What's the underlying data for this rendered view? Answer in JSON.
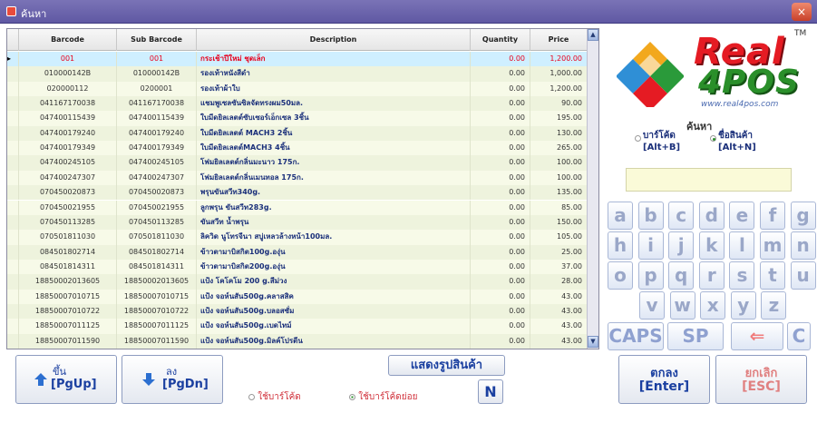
{
  "window": {
    "title": "ค้นหา",
    "close_label": "×"
  },
  "grid": {
    "columns": [
      "Barcode",
      "Sub Barcode",
      "Description",
      "Quantity",
      "Price"
    ],
    "rows": [
      {
        "marker": "▸",
        "barcode": "001",
        "sub": "001",
        "desc": "กระเช้าปีใหม่ ชุดเล็ก",
        "qty": "0.00",
        "price": "1,200.00"
      },
      {
        "marker": "",
        "barcode": "010000142B",
        "sub": "010000142B",
        "desc": "รองเท้าหนังสีดำ",
        "qty": "0.00",
        "price": "1,000.00"
      },
      {
        "marker": "",
        "barcode": "020000112",
        "sub": "0200001",
        "desc": "รองเท้าผ้าใบ",
        "qty": "0.00",
        "price": "1,200.00"
      },
      {
        "marker": "",
        "barcode": "041167170038",
        "sub": "041167170038",
        "desc": "แชมพูเซลซันซิลจัดทรงผม50มล.",
        "qty": "0.00",
        "price": "90.00"
      },
      {
        "marker": "",
        "barcode": "047400115439",
        "sub": "047400115439",
        "desc": "ใบมีดยิลเลตต์ซับเซอร์เอ็กเซล 3ชิ้น",
        "qty": "0.00",
        "price": "195.00"
      },
      {
        "marker": "",
        "barcode": "047400179240",
        "sub": "047400179240",
        "desc": "ใบมีดยิลเลตต์ MACH3 2ชิ้น",
        "qty": "0.00",
        "price": "130.00"
      },
      {
        "marker": "",
        "barcode": "047400179349",
        "sub": "047400179349",
        "desc": "ใบมีดยิลเลตต์MACH3 4ชิ้น",
        "qty": "0.00",
        "price": "265.00"
      },
      {
        "marker": "",
        "barcode": "047400245105",
        "sub": "047400245105",
        "desc": "โฟมยิลเลตต์กลิ่นมะนาว 175ก.",
        "qty": "0.00",
        "price": "100.00"
      },
      {
        "marker": "",
        "barcode": "047400247307",
        "sub": "047400247307",
        "desc": "โฟมยิลเลตต์กลิ่นเมนทอล 175ก.",
        "qty": "0.00",
        "price": "100.00"
      },
      {
        "marker": "",
        "barcode": "070450020873",
        "sub": "070450020873",
        "desc": "พรุนขันสวีท340g.",
        "qty": "0.00",
        "price": "135.00"
      },
      {
        "marker": "",
        "barcode": "070450021955",
        "sub": "070450021955",
        "desc": "ลูกพรุน ขันสวีท283g.",
        "qty": "0.00",
        "price": "85.00"
      },
      {
        "marker": "",
        "barcode": "070450113285",
        "sub": "070450113285",
        "desc": "ขันสวีท น้ำพรุน",
        "qty": "0.00",
        "price": "150.00"
      },
      {
        "marker": "",
        "barcode": "070501811030",
        "sub": "070501811030",
        "desc": "ลิควิด นูโทรจีนา สบู่เหลวล้างหน้า100มล.",
        "qty": "0.00",
        "price": "105.00"
      },
      {
        "marker": "",
        "barcode": "084501802714",
        "sub": "084501802714",
        "desc": "ข้าวตามาบิสกิต100g.องุ่น",
        "qty": "0.00",
        "price": "25.00"
      },
      {
        "marker": "",
        "barcode": "084501814311",
        "sub": "084501814311",
        "desc": "ข้าวตามาบิสกิต200g.องุ่น",
        "qty": "0.00",
        "price": "37.00"
      },
      {
        "marker": "",
        "barcode": "18850002013605",
        "sub": "18850002013605",
        "desc": "แป้ง โคโคโม 200 g.สีม่วง",
        "qty": "0.00",
        "price": "28.00"
      },
      {
        "marker": "",
        "barcode": "18850007010715",
        "sub": "18850007010715",
        "desc": "แป้ง จอห์นสัน500g.คลาสสิค",
        "qty": "0.00",
        "price": "43.00"
      },
      {
        "marker": "",
        "barcode": "18850007010722",
        "sub": "18850007010722",
        "desc": "แป้ง จอห์นสัน500g.บลอสซั่ม",
        "qty": "0.00",
        "price": "43.00"
      },
      {
        "marker": "",
        "barcode": "18850007011125",
        "sub": "18850007011125",
        "desc": "แป้ง จอห์นสัน500g.เบดไทม์",
        "qty": "0.00",
        "price": "43.00"
      },
      {
        "marker": "",
        "barcode": "18850007011590",
        "sub": "18850007011590",
        "desc": "แป้ง จอห์นสัน500g.มิลค์โปรตีน",
        "qty": "0.00",
        "price": "43.00"
      }
    ]
  },
  "logo": {
    "word1": "Real",
    "word2": "4POS",
    "tm": "TM",
    "url": "www.real4pos.com"
  },
  "search": {
    "title": "ค้นหา",
    "radio_barcode": "บาร์โค้ด",
    "radio_barcode_key": "[Alt+B]",
    "radio_name": "ชื่อสินค้า",
    "radio_name_key": "[Alt+N]",
    "input_value": ""
  },
  "keyboard": {
    "row1": [
      "a",
      "b",
      "c",
      "d",
      "e",
      "f",
      "g"
    ],
    "row2": [
      "h",
      "i",
      "j",
      "k",
      "l",
      "m",
      "n"
    ],
    "row3": [
      "o",
      "p",
      "q",
      "r",
      "s",
      "t",
      "u"
    ],
    "row4": [
      "v",
      "w",
      "x",
      "y",
      "z"
    ],
    "caps": "CAPS",
    "space": "SP",
    "backspace": "⇐",
    "clear": "C"
  },
  "bottom": {
    "up_label": "ขึ้น",
    "up_key": "[PgUp]",
    "down_label": "ลง",
    "down_key": "[PgDn]",
    "show_image": "แสดงรูปสินค้า",
    "n_button": "N",
    "radio_barcode": "ใช้บาร์โค้ด",
    "radio_sub_barcode": "ใช้บาร์โค้ดย่อย",
    "ok_label": "ตกลง",
    "ok_key": "[Enter]",
    "cancel_label": "ยกเลิก",
    "cancel_key": "[ESC]"
  },
  "colors": {
    "selected_row_text": "#e8001c",
    "description_text": "#1a2f7a",
    "logo_red": "#e51b23",
    "logo_green": "#2a8f2a",
    "cancel_text": "#e08080"
  }
}
